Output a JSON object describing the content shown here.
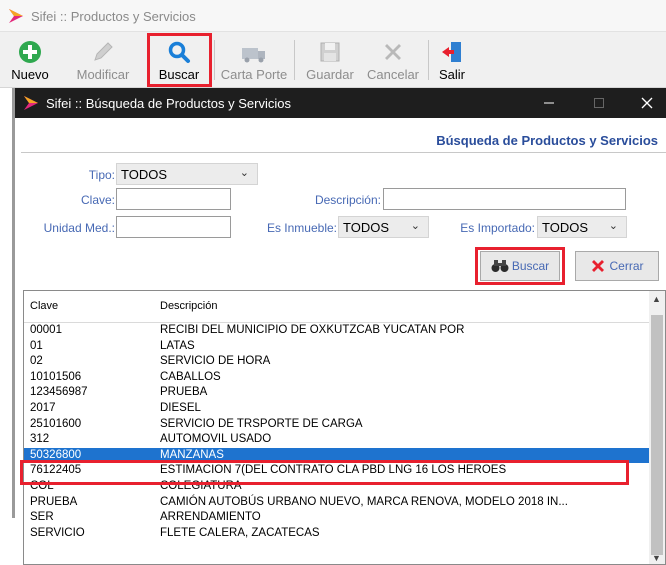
{
  "app": {
    "title": "Sifei :: Productos y Servicios"
  },
  "toolbar": {
    "buttons": [
      {
        "label": "Nuevo",
        "icon": "plus-circle-icon",
        "enabled": true
      },
      {
        "label": "Modificar",
        "icon": "pencil-icon",
        "enabled": false
      },
      {
        "label": "Buscar",
        "icon": "search-icon",
        "enabled": true,
        "highlighted": true
      },
      {
        "label": "Carta Porte",
        "icon": "truck-icon",
        "enabled": false
      },
      {
        "label": "Guardar",
        "icon": "save-icon",
        "enabled": false
      },
      {
        "label": "Cancelar",
        "icon": "cancel-x-icon",
        "enabled": false
      },
      {
        "label": "Salir",
        "icon": "exit-door-icon",
        "enabled": true
      }
    ]
  },
  "dialog": {
    "title": "Sifei :: Búsqueda de Productos y Servicios",
    "heading": "Búsqueda de Productos y Servicios",
    "form": {
      "tipo_label": "Tipo:",
      "tipo_value": "TODOS",
      "clave_label": "Clave:",
      "clave_value": "",
      "descripcion_label": "Descripción:",
      "descripcion_value": "",
      "unidad_label": "Unidad Med.:",
      "unidad_value": "",
      "inmueble_label": "Es Inmueble:",
      "inmueble_value": "TODOS",
      "importado_label": "Es Importado:",
      "importado_value": "TODOS"
    },
    "buttons": {
      "buscar": "Buscar",
      "cerrar": "Cerrar"
    },
    "table": {
      "columns": [
        "Clave",
        "Descripción"
      ],
      "rows": [
        [
          "00001",
          "RECIBI DEL MUNICIPIO DE OXKUTZCAB YUCATAN POR"
        ],
        [
          "01",
          "LATAS"
        ],
        [
          "02",
          "SERVICIO DE HORA"
        ],
        [
          "10101506",
          "CABALLOS"
        ],
        [
          "123456987",
          "PRUEBA"
        ],
        [
          "2017",
          "DIESEL"
        ],
        [
          "25101600",
          "SERVICIO DE TRSPORTE DE CARGA"
        ],
        [
          "312",
          "AUTOMOVIL USADO"
        ],
        [
          "50326800",
          "MANZANAS"
        ],
        [
          "76122405",
          "ESTIMACION 7(DEL CONTRATO CLA PBD LNG 16 LOS HEROES"
        ],
        [
          "COL",
          "COLEGIATURA"
        ],
        [
          "PRUEBA",
          "CAMIÓN AUTOBÚS  URBANO  NUEVO, MARCA RENOVA, MODELO 2018 IN..."
        ],
        [
          "SER",
          "ARRENDAMIENTO"
        ],
        [
          "SERVICIO",
          "FLETE CALERA, ZACATECAS"
        ]
      ],
      "selected_index": 8
    }
  },
  "colors": {
    "highlight": "#e8202e",
    "selection": "#1e73cf",
    "label": "#4769b4",
    "heading": "#2a4d9b"
  }
}
